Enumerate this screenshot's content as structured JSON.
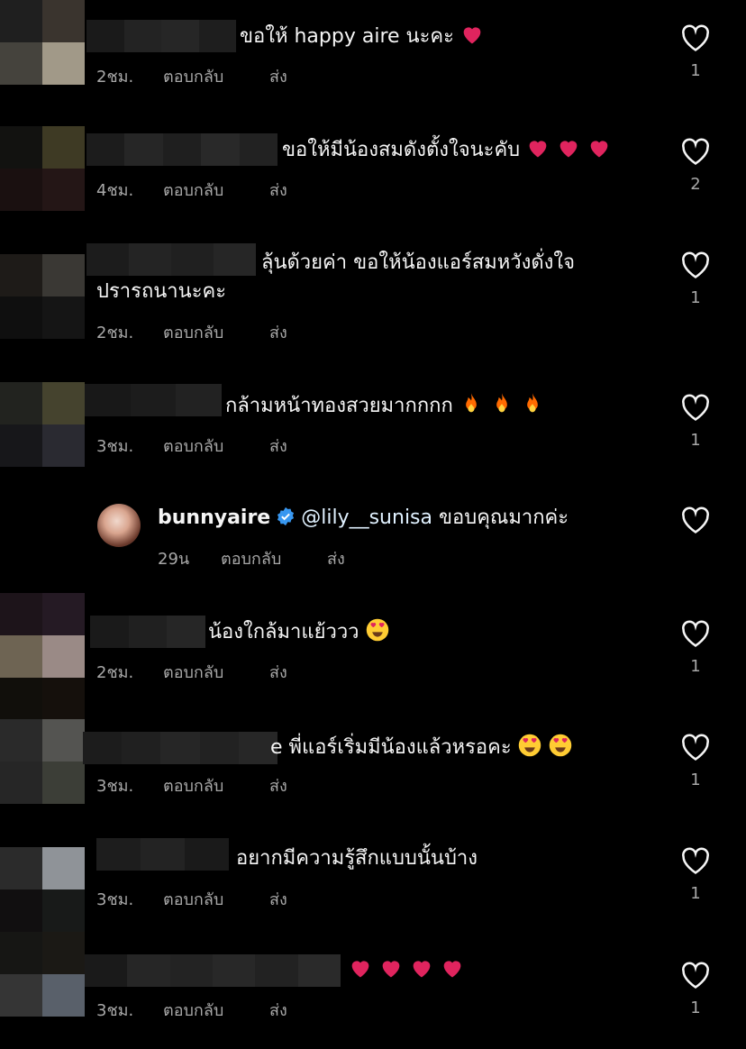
{
  "comments": [
    {
      "text": "ขอให้ happy aire นะคะ",
      "emoji": [
        "heart"
      ],
      "time": "2ชม.",
      "reply": "ตอบกลับ",
      "send": "ส่ง",
      "likes": "1"
    },
    {
      "text": "ขอให้มีน้องสมดังตั้งใจนะคับ",
      "emoji": [
        "heart",
        "heart",
        "heart"
      ],
      "time": "4ชม.",
      "reply": "ตอบกลับ",
      "send": "ส่ง",
      "likes": "2"
    },
    {
      "text": "ลุ้นด้วยค่า ขอให้น้องแอร์สมหวังดั่งใจ",
      "text2": "ปรารถนานะคะ",
      "emoji": [],
      "time": "2ชม.",
      "reply": "ตอบกลับ",
      "send": "ส่ง",
      "likes": "1"
    },
    {
      "text": "กล้ามหน้าทองสวยมากกกก",
      "emoji": [
        "fire",
        "fire",
        "fire"
      ],
      "time": "3ชม.",
      "reply": "ตอบกลับ",
      "send": "ส่ง",
      "likes": "1"
    },
    {
      "username": "bunnyaire",
      "mention": "@lily__sunisa",
      "text": "ขอบคุณมากค่ะ",
      "time": "29น",
      "reply": "ตอบกลับ",
      "send": "ส่ง",
      "likes": ""
    },
    {
      "text": "น้องใกล้มาแย้ววว",
      "emoji": [
        "hearteyes"
      ],
      "time": "2ชม.",
      "reply": "ตอบกลับ",
      "send": "ส่ง",
      "likes": "1"
    },
    {
      "text": "e พี่แอร์เริ่มมีน้องแล้วหรอคะ",
      "emoji": [
        "hearteyes",
        "hearteyes"
      ],
      "time": "3ชม.",
      "reply": "ตอบกลับ",
      "send": "ส่ง",
      "likes": "1"
    },
    {
      "text": "อยากมีความรู้สึกแบบนั้นบ้าง",
      "emoji": [],
      "time": "3ชม.",
      "reply": "ตอบกลับ",
      "send": "ส่ง",
      "likes": "1"
    },
    {
      "text": "",
      "emoji": [
        "heart",
        "heart",
        "heart",
        "heart"
      ],
      "time": "3ชม.",
      "reply": "ตอบกลับ",
      "send": "ส่ง",
      "likes": "1"
    }
  ],
  "colors": {
    "background": "#000000",
    "text": "#f5f5f5",
    "meta": "#a8a8a8",
    "verified": "#3897f0",
    "heart": "#e0245e",
    "fire": "#ff6a00",
    "hearteyes": "#ffcc33"
  },
  "icons": {
    "like": "heart-outline-icon",
    "verified": "verified-badge-icon"
  }
}
